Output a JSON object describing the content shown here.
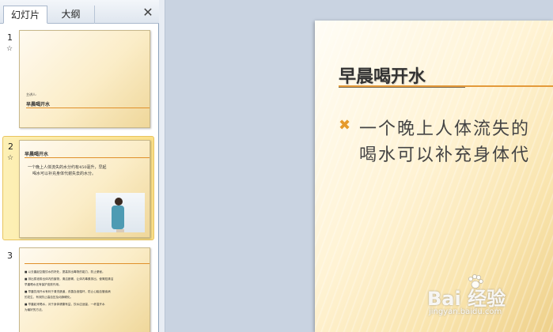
{
  "panel": {
    "tabs": [
      {
        "label": "幻灯片"
      },
      {
        "label": "大纲"
      }
    ],
    "close_icon": "close-icon"
  },
  "thumbnails": [
    {
      "number": "1",
      "subtitle": "主讲人:",
      "title": "早晨喝开水"
    },
    {
      "number": "2",
      "title": "早晨喝开水",
      "bullets": [
        "一个晚上人体流失的水分约有450毫升，早起",
        "喝水可以补充身体代谢失去的水分。"
      ]
    },
    {
      "number": "3",
      "lines": [
        "■ 以去晨起空腹饮水的好处，提高排出毒物的能力，防止便秘。",
        "■ 排出尿液带出体内的废物，清洁肠胃，让体内毒素排出，使胃腔清洁",
        "  早晨喝水还有保护皮肤作用。",
        "■ 早晨饮用开水有利于清洗肠道，改善血液循环，防止心脑血管疾病",
        "  的发生，有效防止高血压及动脉硬化。",
        "■ 早晨起来喝水，对于身体健康有益，饮水应适量，一杯温开水",
        "  为最好的方法。"
      ]
    }
  ],
  "slide": {
    "title": "早晨喝开水",
    "bullet_lines": [
      "一个晚上人体流失的",
      "喝水可以补充身体代"
    ]
  },
  "watermark": {
    "brand": "Bai  经验",
    "url": "jingyan.baidu.com"
  },
  "colors": {
    "accent": "#e59a2c",
    "selected_bg": "#fbe08a"
  }
}
